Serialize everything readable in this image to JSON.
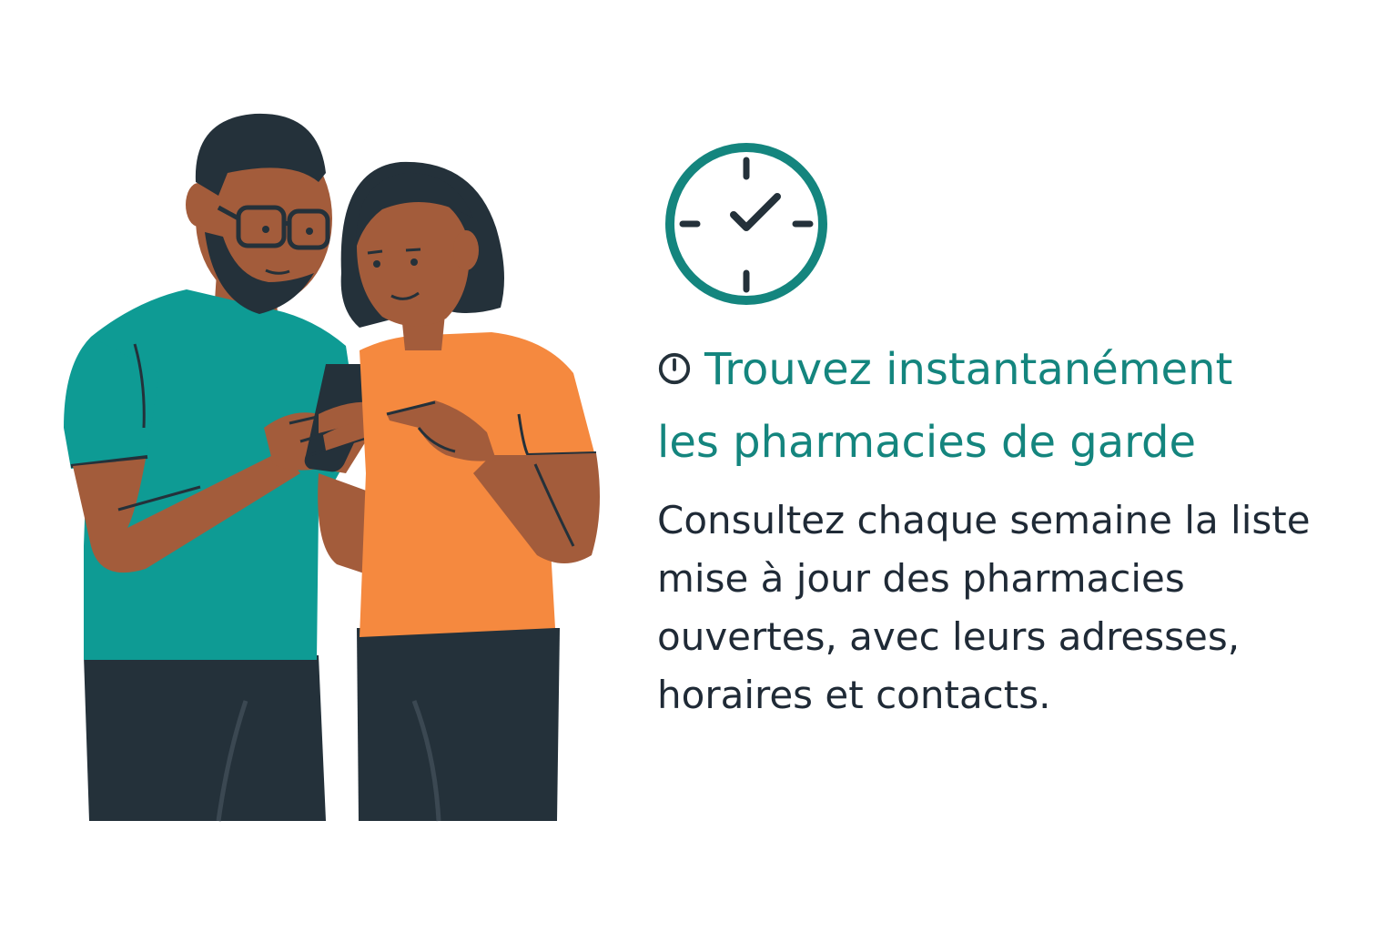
{
  "headline": {
    "line1": "Trouvez instantanément",
    "line2": "les pharmacies de garde"
  },
  "body": {
    "lines": [
      "Consultez chaque semaine la liste",
      "mise à jour des pharmacies",
      "ouvertes, avec leurs adresses,",
      "horaires et contacts."
    ]
  },
  "icons": {
    "large": "clock-check-icon",
    "inline": "clock-icon"
  },
  "colors": {
    "teal_accent": "#14857e",
    "body_text": "#1f2a36",
    "man_shirt": "#0e9b94",
    "woman_shirt": "#f5893f",
    "skin": "#a35c3b",
    "hair_pants": "#24313a"
  }
}
